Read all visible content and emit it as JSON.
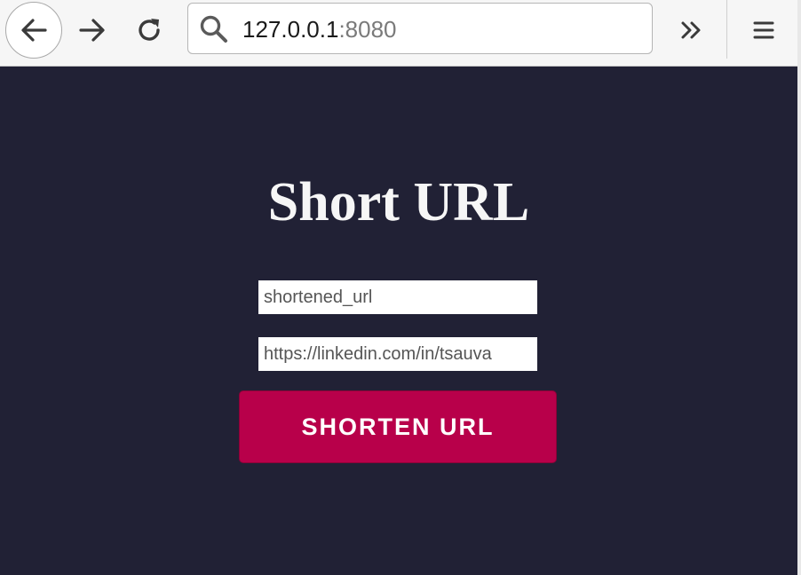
{
  "browser": {
    "url_host": "127.0.0.1",
    "url_port": ":8080",
    "icons": {
      "back": "back-arrow-icon",
      "forward": "forward-arrow-icon",
      "reload": "reload-icon",
      "search": "search-icon",
      "overflow": "double-chevron-icon",
      "menu": "hamburger-menu-icon"
    }
  },
  "page": {
    "title": "Short URL",
    "short_name_value": "shortened_url",
    "long_url_value": "https://linkedin.com/in/tsauva",
    "button_label": "SHORTEN URL"
  },
  "colors": {
    "background": "#212135",
    "button": "#b8004a",
    "title": "#f6f6f6"
  }
}
